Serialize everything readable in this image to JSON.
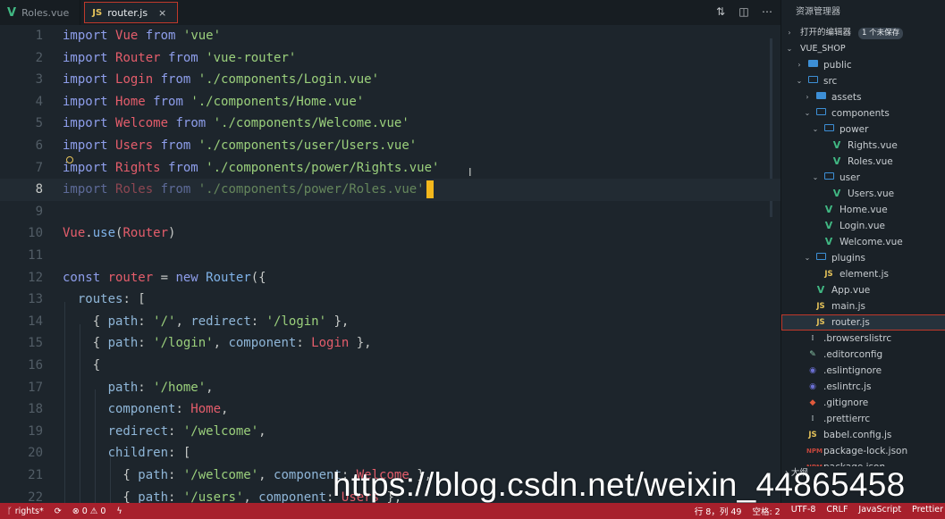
{
  "tabs": [
    {
      "label": "Roles.vue",
      "icon": "V",
      "active": false
    },
    {
      "label": "router.js",
      "icon": "JS",
      "active": true,
      "close": "×"
    }
  ],
  "editor": {
    "lines": [
      {
        "n": "1",
        "tokens": [
          [
            "kw",
            "import "
          ],
          [
            "id",
            "Vue"
          ],
          [
            "kw",
            " from "
          ],
          [
            "str",
            "'vue'"
          ]
        ]
      },
      {
        "n": "2",
        "tokens": [
          [
            "kw",
            "import "
          ],
          [
            "id",
            "Router"
          ],
          [
            "kw",
            " from "
          ],
          [
            "str",
            "'vue-router'"
          ]
        ]
      },
      {
        "n": "3",
        "tokens": [
          [
            "kw",
            "import "
          ],
          [
            "id",
            "Login"
          ],
          [
            "kw",
            " from "
          ],
          [
            "str",
            "'./components/Login.vue'"
          ]
        ]
      },
      {
        "n": "4",
        "tokens": [
          [
            "kw",
            "import "
          ],
          [
            "id",
            "Home"
          ],
          [
            "kw",
            " from "
          ],
          [
            "str",
            "'./components/Home.vue'"
          ]
        ]
      },
      {
        "n": "5",
        "tokens": [
          [
            "kw",
            "import "
          ],
          [
            "id",
            "Welcome"
          ],
          [
            "kw",
            " from "
          ],
          [
            "str",
            "'./components/Welcome.vue'"
          ]
        ]
      },
      {
        "n": "6",
        "tokens": [
          [
            "kw",
            "import "
          ],
          [
            "id",
            "Users"
          ],
          [
            "kw",
            " from "
          ],
          [
            "str",
            "'./components/user/Users.vue'"
          ]
        ]
      },
      {
        "n": "7",
        "tokens": [
          [
            "kw",
            "import "
          ],
          [
            "id",
            "Rights"
          ],
          [
            "kw",
            " from "
          ],
          [
            "str",
            "'./components/power/Rights.vue'"
          ]
        ]
      },
      {
        "n": "8",
        "tokens": [
          [
            "kw dim",
            "import "
          ],
          [
            "id dim",
            "Roles"
          ],
          [
            "kw dim",
            " from "
          ],
          [
            "str dim",
            "'./components/power/Roles.vue'"
          ]
        ],
        "current": true
      },
      {
        "n": "9",
        "tokens": []
      },
      {
        "n": "10",
        "tokens": [
          [
            "id",
            "Vue"
          ],
          [
            "pl",
            "."
          ],
          [
            "fn",
            "use"
          ],
          [
            "pl",
            "("
          ],
          [
            "id",
            "Router"
          ],
          [
            "pl",
            ")"
          ]
        ]
      },
      {
        "n": "11",
        "tokens": []
      },
      {
        "n": "12",
        "tokens": [
          [
            "kw",
            "const "
          ],
          [
            "id",
            "router"
          ],
          [
            "pl",
            " = "
          ],
          [
            "kw",
            "new "
          ],
          [
            "fn",
            "Router"
          ],
          [
            "pl",
            "({"
          ]
        ]
      },
      {
        "n": "13",
        "tokens": [
          [
            "pl",
            "  "
          ],
          [
            "prop",
            "routes"
          ],
          [
            "pl",
            ": ["
          ]
        ]
      },
      {
        "n": "14",
        "tokens": [
          [
            "pl",
            "    { "
          ],
          [
            "prop",
            "path"
          ],
          [
            "pl",
            ": "
          ],
          [
            "str",
            "'/'"
          ],
          [
            "pl",
            ", "
          ],
          [
            "prop",
            "redirect"
          ],
          [
            "pl",
            ": "
          ],
          [
            "str",
            "'/login'"
          ],
          [
            "pl",
            " },"
          ]
        ]
      },
      {
        "n": "15",
        "tokens": [
          [
            "pl",
            "    { "
          ],
          [
            "prop",
            "path"
          ],
          [
            "pl",
            ": "
          ],
          [
            "str",
            "'/login'"
          ],
          [
            "pl",
            ", "
          ],
          [
            "prop",
            "component"
          ],
          [
            "pl",
            ": "
          ],
          [
            "id",
            "Login"
          ],
          [
            "pl",
            " },"
          ]
        ]
      },
      {
        "n": "16",
        "tokens": [
          [
            "pl",
            "    {"
          ]
        ]
      },
      {
        "n": "17",
        "tokens": [
          [
            "pl",
            "      "
          ],
          [
            "prop",
            "path"
          ],
          [
            "pl",
            ": "
          ],
          [
            "str",
            "'/home'"
          ],
          [
            "pl",
            ","
          ]
        ]
      },
      {
        "n": "18",
        "tokens": [
          [
            "pl",
            "      "
          ],
          [
            "prop",
            "component"
          ],
          [
            "pl",
            ": "
          ],
          [
            "id",
            "Home"
          ],
          [
            "pl",
            ","
          ]
        ]
      },
      {
        "n": "19",
        "tokens": [
          [
            "pl",
            "      "
          ],
          [
            "prop",
            "redirect"
          ],
          [
            "pl",
            ": "
          ],
          [
            "str",
            "'/welcome'"
          ],
          [
            "pl",
            ","
          ]
        ]
      },
      {
        "n": "20",
        "tokens": [
          [
            "pl",
            "      "
          ],
          [
            "prop",
            "children"
          ],
          [
            "pl",
            ": ["
          ]
        ]
      },
      {
        "n": "21",
        "tokens": [
          [
            "pl",
            "        { "
          ],
          [
            "prop",
            "path"
          ],
          [
            "pl",
            ": "
          ],
          [
            "str",
            "'/welcome'"
          ],
          [
            "pl",
            ", "
          ],
          [
            "prop",
            "component"
          ],
          [
            "pl",
            ": "
          ],
          [
            "id",
            "Welcome"
          ],
          [
            "pl",
            " },"
          ]
        ]
      },
      {
        "n": "22",
        "tokens": [
          [
            "pl",
            "        { "
          ],
          [
            "prop",
            "path"
          ],
          [
            "pl",
            ": "
          ],
          [
            "str",
            "'/users'"
          ],
          [
            "pl",
            ", "
          ],
          [
            "prop",
            "component"
          ],
          [
            "pl",
            ": "
          ],
          [
            "id",
            "Users"
          ],
          [
            "pl",
            " },"
          ]
        ]
      }
    ]
  },
  "explorer": {
    "title": "资源管理器",
    "open_editors_label": "打开的编辑器",
    "unsaved_badge": "1 个未保存",
    "project_label": "VUE_SHOP",
    "outline_label": "大纲",
    "items": [
      {
        "label": "public",
        "depth": 1,
        "kind": "folder-closed",
        "chev": "›"
      },
      {
        "label": "src",
        "depth": 1,
        "kind": "folder-open",
        "chev": "⌄"
      },
      {
        "label": "assets",
        "depth": 2,
        "kind": "folder-closed",
        "chev": "›"
      },
      {
        "label": "components",
        "depth": 2,
        "kind": "folder-open",
        "chev": "⌄"
      },
      {
        "label": "power",
        "depth": 3,
        "kind": "folder-open",
        "chev": "⌄"
      },
      {
        "label": "Rights.vue",
        "depth": 4,
        "kind": "vue"
      },
      {
        "label": "Roles.vue",
        "depth": 4,
        "kind": "vue"
      },
      {
        "label": "user",
        "depth": 3,
        "kind": "folder-open",
        "chev": "⌄"
      },
      {
        "label": "Users.vue",
        "depth": 4,
        "kind": "vue"
      },
      {
        "label": "Home.vue",
        "depth": 3,
        "kind": "vue"
      },
      {
        "label": "Login.vue",
        "depth": 3,
        "kind": "vue"
      },
      {
        "label": "Welcome.vue",
        "depth": 3,
        "kind": "vue"
      },
      {
        "label": "plugins",
        "depth": 2,
        "kind": "folder-open",
        "chev": "⌄"
      },
      {
        "label": "element.js",
        "depth": 3,
        "kind": "js"
      },
      {
        "label": "App.vue",
        "depth": 2,
        "kind": "vue"
      },
      {
        "label": "main.js",
        "depth": 2,
        "kind": "js"
      },
      {
        "label": "router.js",
        "depth": 2,
        "kind": "js",
        "selected": true
      },
      {
        "label": ".browserslistrc",
        "depth": 1,
        "kind": "dot"
      },
      {
        "label": ".editorconfig",
        "depth": 1,
        "kind": "edit"
      },
      {
        "label": ".eslintignore",
        "depth": 1,
        "kind": "eslint"
      },
      {
        "label": ".eslintrc.js",
        "depth": 1,
        "kind": "eslint"
      },
      {
        "label": ".gitignore",
        "depth": 1,
        "kind": "git"
      },
      {
        "label": ".prettierrc",
        "depth": 1,
        "kind": "dot"
      },
      {
        "label": "babel.config.js",
        "depth": 1,
        "kind": "js"
      },
      {
        "label": "package-lock.json",
        "depth": 1,
        "kind": "json"
      },
      {
        "label": "package.json",
        "depth": 1,
        "kind": "json"
      }
    ]
  },
  "statusbar": {
    "branch": "rights*",
    "problems": "⊗ 0 ⚠ 0",
    "position": "行 8，列 49",
    "spaces": "空格: 2",
    "encoding": "UTF-8",
    "eol": "CRLF",
    "language": "JavaScript",
    "formatter": "Prettier"
  },
  "watermark": "https://blog.csdn.net/weixin_44865458",
  "colors": {
    "accent": "#a7202c",
    "keyword": "#8e9eeb",
    "identifier": "#e45d6b",
    "string": "#9bd07c"
  }
}
